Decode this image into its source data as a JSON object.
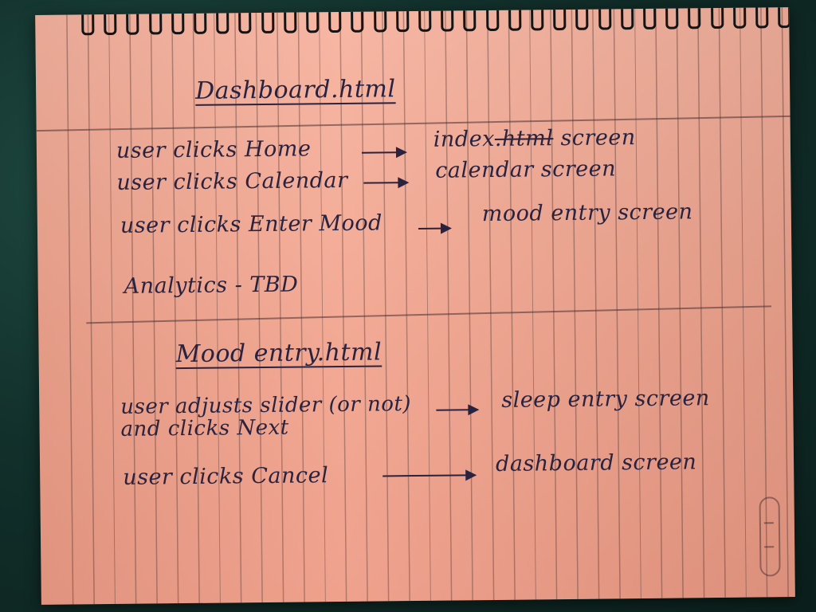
{
  "notebook": {
    "section1": {
      "title": "Dashboard.html",
      "rows": [
        {
          "action": "user clicks Home",
          "result_pre": "index",
          "result_struck": ".html",
          "result_post": "screen"
        },
        {
          "action": "user clicks Calendar",
          "result": "calendar screen"
        },
        {
          "action": "user clicks Enter Mood",
          "result": "mood entry screen"
        },
        {
          "note": "Analytics - TBD"
        }
      ]
    },
    "section2": {
      "title": "Mood entry.html",
      "rows": [
        {
          "action_line1": "user adjusts slider (or not)",
          "action_line2": "and clicks Next",
          "result": "sleep entry screen"
        },
        {
          "action": "user clicks Cancel",
          "result": "dashboard screen"
        }
      ]
    }
  },
  "colors": {
    "paper": "#f2a58f",
    "ink": "#2a2340",
    "background": "#12302b"
  }
}
